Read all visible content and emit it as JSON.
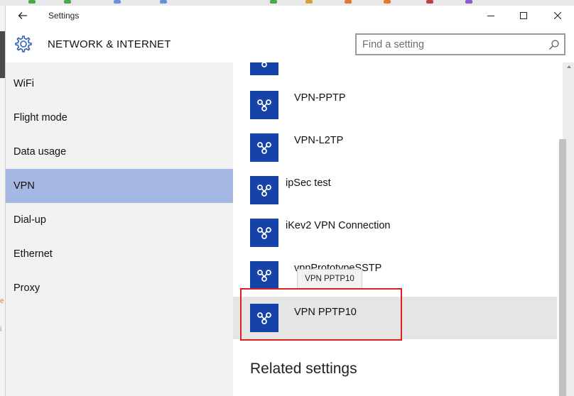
{
  "window": {
    "title": "Settings",
    "controls": {
      "minimize": "minimize",
      "maximize": "maximize",
      "close": "close"
    }
  },
  "header": {
    "title": "NETWORK & INTERNET",
    "icon": "gear-icon"
  },
  "search": {
    "placeholder": "Find a setting",
    "value": ""
  },
  "sidebar": {
    "items": [
      {
        "label": "WiFi",
        "selected": false
      },
      {
        "label": "Flight mode",
        "selected": false
      },
      {
        "label": "Data usage",
        "selected": false
      },
      {
        "label": "VPN",
        "selected": true
      },
      {
        "label": "Dial-up",
        "selected": false
      },
      {
        "label": "Ethernet",
        "selected": false
      },
      {
        "label": "Proxy",
        "selected": false
      }
    ],
    "selected_color": "#a4b8e3"
  },
  "vpn_list": {
    "icon": "vpn-connection-icon",
    "icon_color": "#1643a8",
    "items": [
      {
        "name": "",
        "partially_visible": true
      },
      {
        "name": "VPN-PPTP"
      },
      {
        "name": "VPN-L2TP"
      },
      {
        "name": "ipSec test"
      },
      {
        "name": "iKev2 VPN Connection"
      },
      {
        "name": "vpnPrototypeSSTP"
      },
      {
        "name": "VPN PPTP10",
        "selected": true
      }
    ]
  },
  "tooltip": {
    "text": "VPN PPTP10"
  },
  "annotation": {
    "color": "#e02020"
  },
  "related_settings": {
    "heading": "Related settings"
  }
}
